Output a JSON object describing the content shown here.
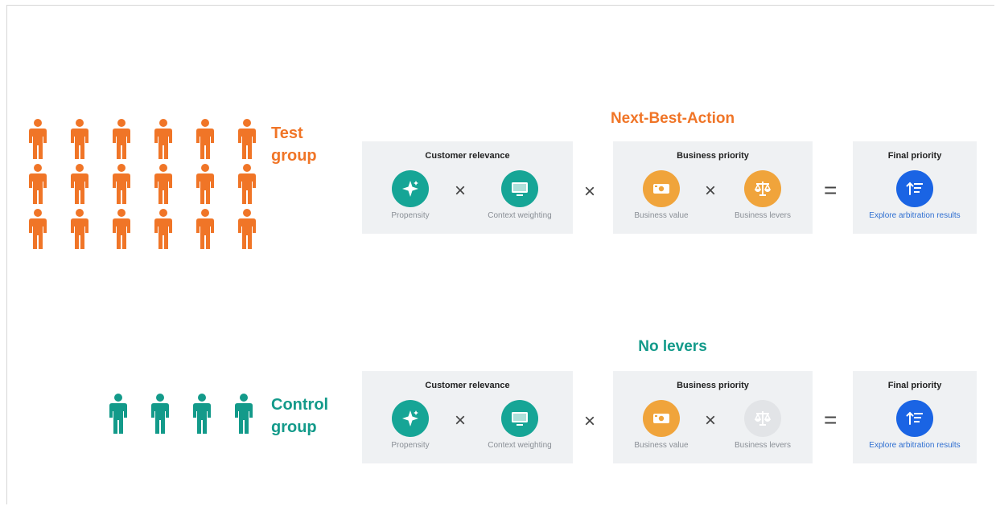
{
  "colors": {
    "test": "#f07527",
    "control": "#139a8a",
    "teal_icon": "#16a596",
    "gold_icon": "#f0a43b",
    "disabled_icon": "#e2e4e7",
    "blue_icon": "#1a64e4"
  },
  "test_group": {
    "line1": "Test",
    "line2": "group",
    "people_count": 18
  },
  "control_group": {
    "line1": "Control",
    "line2": "group",
    "people_count": 4
  },
  "rows": [
    {
      "title": "Next-Best-Action",
      "customer_relevance": {
        "title": "Customer relevance",
        "items": [
          {
            "label": "Propensity",
            "icon": "sparkle-icon"
          },
          {
            "label": "Context weighting",
            "icon": "monitor-icon"
          }
        ]
      },
      "business_priority": {
        "title": "Business priority",
        "items": [
          {
            "label": "Business value",
            "icon": "money-icon"
          },
          {
            "label": "Business levers",
            "icon": "scales-icon",
            "active": true
          }
        ]
      },
      "final_priority": {
        "title": "Final priority",
        "label": "Explore arbitration results",
        "icon": "sort-icon"
      },
      "ops": {
        "multiply": "×",
        "equals": "="
      }
    },
    {
      "title": "No levers",
      "customer_relevance": {
        "title": "Customer relevance",
        "items": [
          {
            "label": "Propensity",
            "icon": "sparkle-icon"
          },
          {
            "label": "Context weighting",
            "icon": "monitor-icon"
          }
        ]
      },
      "business_priority": {
        "title": "Business priority",
        "items": [
          {
            "label": "Business value",
            "icon": "money-icon"
          },
          {
            "label": "Business levers",
            "icon": "scales-icon",
            "active": false
          }
        ]
      },
      "final_priority": {
        "title": "Final priority",
        "label": "Explore arbitration results",
        "icon": "sort-icon"
      },
      "ops": {
        "multiply": "×",
        "equals": "="
      }
    }
  ]
}
